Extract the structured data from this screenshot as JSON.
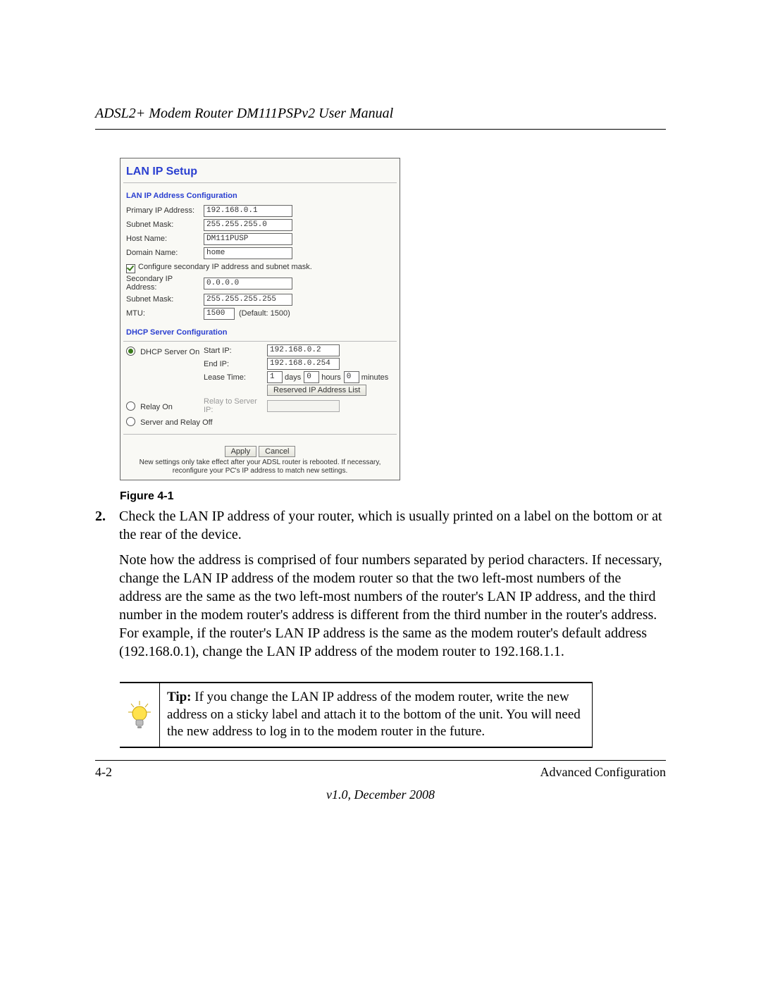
{
  "header": {
    "running_head": "ADSL2+ Modem Router DM111PSPv2 User Manual"
  },
  "router": {
    "title": "LAN IP Setup",
    "lan_section": "LAN IP Address Configuration",
    "primary_ip_label": "Primary IP Address:",
    "primary_ip": "192.168.0.1",
    "subnet1_label": "Subnet Mask:",
    "subnet1": "255.255.255.0",
    "hostname_label": "Host Name:",
    "hostname": "DM111PUSP",
    "domain_label": "Domain Name:",
    "domain": "home",
    "secondary_chk_label": "Configure secondary IP address and subnet mask.",
    "secondary_ip_label": "Secondary IP Address:",
    "secondary_ip": "0.0.0.0",
    "subnet2_label": "Subnet Mask:",
    "subnet2": "255.255.255.255",
    "mtu_label": "MTU:",
    "mtu": "1500",
    "mtu_default": "(Default: 1500)",
    "dhcp_section": "DHCP Server Configuration",
    "dhcp_on_label": "DHCP Server On",
    "start_ip_label": "Start IP:",
    "start_ip": "192.168.0.2",
    "end_ip_label": "End IP:",
    "end_ip": "192.168.0.254",
    "lease_label": "Lease Time:",
    "lease_days": "1",
    "lease_days_unit": "days",
    "lease_hours": "0",
    "lease_hours_unit": "hours",
    "lease_minutes": "0",
    "lease_minutes_unit": "minutes",
    "reserved_btn": "Reserved IP Address List",
    "relay_label": "Relay On",
    "relay_field_label": "Relay to Server IP:",
    "off_label": "Server and Relay Off",
    "apply_btn": "Apply",
    "cancel_btn": "Cancel",
    "footnote": "New settings only take effect after your ADSL router is rebooted. If necessary, reconfigure your PC's IP address to match new settings."
  },
  "figure": {
    "caption": "Figure 4-1"
  },
  "list": {
    "num": "2.",
    "p1": "Check the LAN IP address of your router, which is usually printed on a label on the bottom or at the rear of the device.",
    "p2": "Note how the address is comprised of four numbers separated by period characters. If necessary, change the LAN IP address of the modem router so that the two left-most numbers of the address are the same as the two left-most numbers of the router's LAN IP address, and the third number in the modem router's address is different from the third number in the router's address. For example, if the router's LAN IP address is the same as the modem router's default address (192.168.0.1), change the LAN IP address of the modem router to 192.168.1.1."
  },
  "tip": {
    "label": "Tip:",
    "text": " If you change the LAN IP address of the modem router, write the new address on a sticky label and attach it to the bottom of the unit. You will need the new address to log in to the modem router in the future."
  },
  "footer": {
    "page": "4-2",
    "section": "Advanced Configuration",
    "version": "v1.0, December 2008"
  }
}
